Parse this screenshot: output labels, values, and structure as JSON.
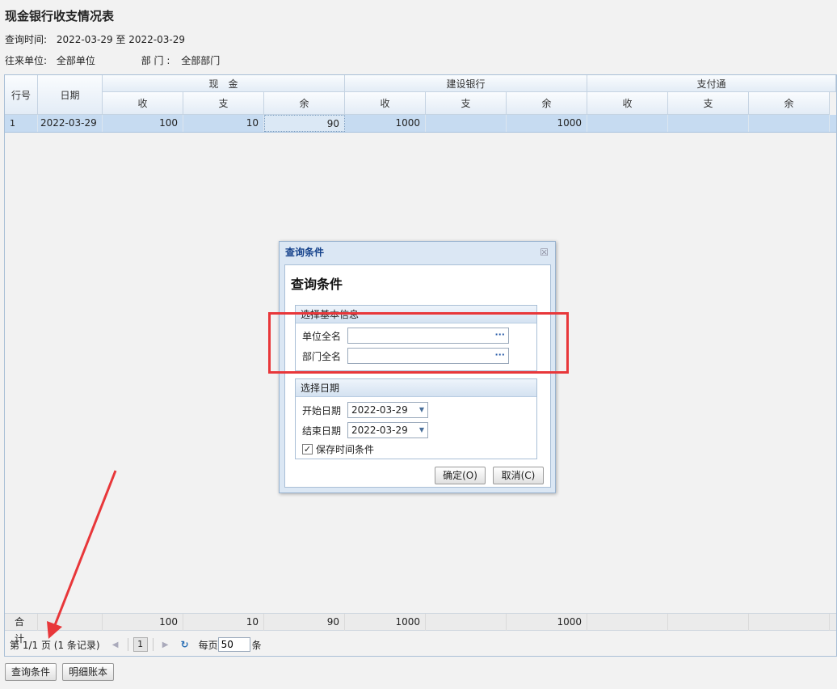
{
  "page": {
    "title": "现金银行收支情况表",
    "query_time_label": "查询时间:",
    "query_time_value": "2022-03-29 至 2022-03-29",
    "partner_label": "往来单位:",
    "partner_value": "全部单位",
    "dept_label": "部 门 :",
    "dept_value": "全部部门"
  },
  "grid": {
    "headers": {
      "row_no": "行号",
      "date": "日期",
      "groups": [
        "现　金",
        "建设银行",
        "支付通"
      ],
      "sub": [
        "收",
        "支",
        "余"
      ]
    },
    "rows": [
      {
        "no": "1",
        "date": "2022-03-29",
        "cash_in": "100",
        "cash_out": "10",
        "cash_bal": "90",
        "ccb_in": "1000",
        "ccb_out": "",
        "ccb_bal": "1000",
        "zft_in": "",
        "zft_out": "",
        "zft_bal": ""
      }
    ],
    "summary": {
      "label": "合计",
      "cash_in": "100",
      "cash_out": "10",
      "cash_bal": "90",
      "ccb_in": "1000",
      "ccb_out": "",
      "ccb_bal": "1000"
    }
  },
  "pager": {
    "page_info": "第 1/1 页 (1 条记录)",
    "current_page": "1",
    "per_page_label": "每页",
    "per_page_value": "50",
    "unit": "条"
  },
  "buttons": {
    "query": "查询条件",
    "detail": "明细账本"
  },
  "dialog": {
    "title": "查询条件",
    "heading": "查询条件",
    "basic_section": "选择基本信息",
    "unit_label": "单位全名",
    "dept_label": "部门全名",
    "date_section": "选择日期",
    "start_label": "开始日期",
    "start_value": "2022-03-29",
    "end_label": "结束日期",
    "end_value": "2022-03-29",
    "save_label": "保存时间条件",
    "ok": "确定(O)",
    "cancel": "取消(C)",
    "close_glyph": "☒"
  },
  "colors": {
    "highlight": "#e8373a",
    "selected_row": "#c6dbf1"
  }
}
